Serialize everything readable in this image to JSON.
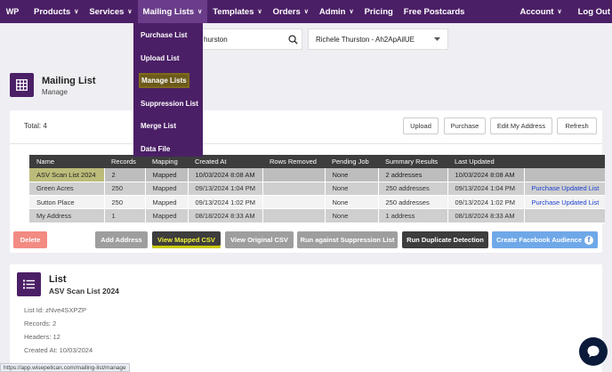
{
  "nav": {
    "logo": "WP",
    "items": [
      {
        "label": "Products",
        "has_chevron": true
      },
      {
        "label": "Services",
        "has_chevron": true
      },
      {
        "label": "Mailing Lists",
        "has_chevron": true
      },
      {
        "label": "Templates",
        "has_chevron": true
      },
      {
        "label": "Orders",
        "has_chevron": true
      },
      {
        "label": "Admin",
        "has_chevron": true
      },
      {
        "label": "Pricing",
        "has_chevron": false
      },
      {
        "label": "Free Postcards",
        "has_chevron": false
      }
    ],
    "account": "Account",
    "logout": "Log Out",
    "chevron": "∨"
  },
  "dropdown": {
    "items": [
      "Purchase List",
      "Upload List",
      "Manage Lists",
      "Suppression List",
      "Merge List",
      "Data File"
    ],
    "highlighted": "Manage Lists"
  },
  "search": {
    "value": "hurston"
  },
  "customer_select": {
    "value": "Richele Thurston - Ah2ApAilUE"
  },
  "page": {
    "title": "Mailing List",
    "subtitle": "Manage"
  },
  "card": {
    "total": "Total: 4",
    "buttons": [
      "Upload",
      "Purchase",
      "Edit My Address",
      "Refresh"
    ]
  },
  "table": {
    "headers": [
      "Name",
      "Records",
      "Mapping",
      "Created At",
      "Rows Removed",
      "Pending Job",
      "Summary Results",
      "Last Updated",
      ""
    ],
    "rows": [
      [
        "ASV Scan List 2024",
        "2",
        "Mapped",
        "10/03/2024 8:08 AM",
        "",
        "None",
        "2 addresses",
        "10/03/2024 8:08 AM",
        ""
      ],
      [
        "Green Acres",
        "250",
        "Mapped",
        "09/13/2024 1:04 PM",
        "",
        "None",
        "250 addresses",
        "09/13/2024 1:04 PM",
        "Purchase Updated List"
      ],
      [
        "Sutton Place",
        "250",
        "Mapped",
        "09/13/2024 1:02 PM",
        "",
        "None",
        "250 addresses",
        "09/13/2024 1:02 PM",
        "Purchase Updated List"
      ],
      [
        "My Address",
        "1",
        "Mapped",
        "08/18/2024 8:33 AM",
        "",
        "None",
        "1 address",
        "08/18/2024 8:33 AM",
        ""
      ]
    ]
  },
  "actions": {
    "delete": "Delete",
    "add_address": "Add Address",
    "view_mapped": "View Mapped CSV",
    "view_original": "View Original CSV",
    "run_suppression": "Run against Suppression List",
    "run_duplicate": "Run Duplicate Detection",
    "create_facebook": "Create Facebook Audience"
  },
  "list_detail": {
    "title": "List",
    "name": "ASV Scan List 2024",
    "list_id": "List Id: zNve4SXPZP",
    "records": "Records: 2",
    "headers": "Headers: 12",
    "created_at": "Created At: 10/03/2024"
  },
  "statusbar": {
    "url": "https://app.wisepelican.com/mailing-list/manage"
  },
  "colors": {
    "nav": "#4b1f66",
    "delete": "#f28b82",
    "gray_button": "#9e9e9e",
    "dark_button": "#3d3d3d",
    "yellow_button": "#e6e600",
    "facebook_button": "#6fa8e8",
    "link": "#1a3fcf"
  }
}
